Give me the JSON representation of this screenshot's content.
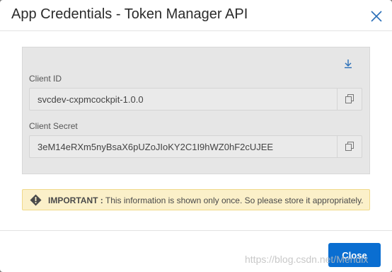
{
  "dialog": {
    "title": "App Credentials - Token Manager API",
    "close_icon": "close-icon"
  },
  "credentials": {
    "download_icon": "download-icon",
    "client_id_label": "Client ID",
    "client_id_value": "svcdev-cxpmcockpit-1.0.0",
    "client_secret_label": "Client Secret",
    "client_secret_value": "3eM14eRXm5nyBsaX6pUZoJIoKY2C1I9hWZ0hF2cUJEE",
    "copy_icon": "copy-icon"
  },
  "alert": {
    "strong": "IMPORTANT :",
    "message": " This information is shown only once. So please store it appropriately.",
    "icon": "warning-icon"
  },
  "footer": {
    "close_label": "Close"
  },
  "watermark": "https://blog.csdn.net/Mendix",
  "colors": {
    "primary": "#0a6ed1",
    "alert_bg": "#fbf0c9",
    "panel_bg": "#e6e6e6"
  }
}
